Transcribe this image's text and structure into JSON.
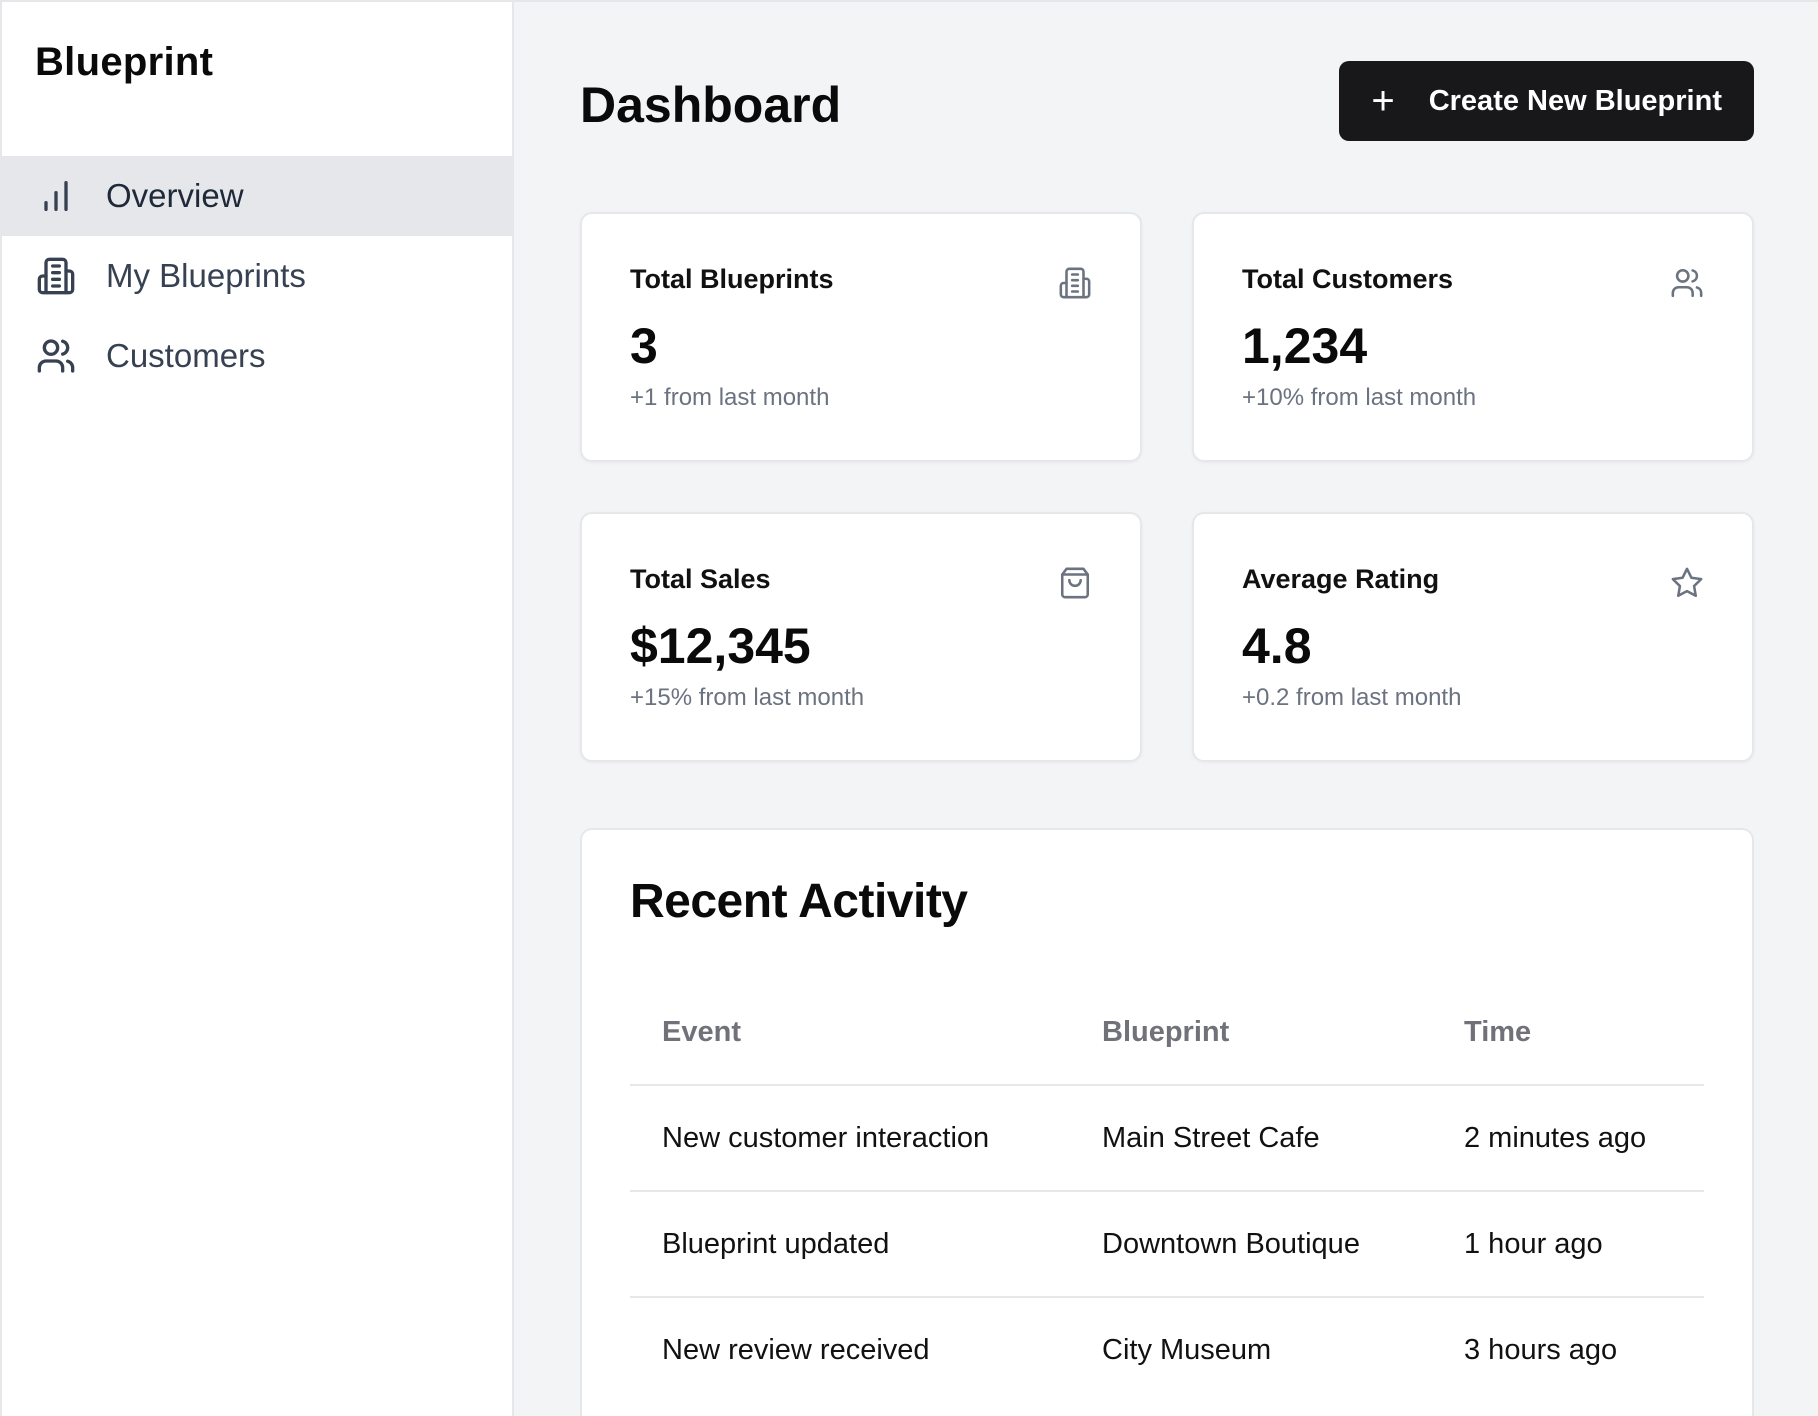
{
  "sidebar": {
    "brand": "Blueprint",
    "items": [
      {
        "label": "Overview",
        "icon": "bar-chart-icon",
        "active": true
      },
      {
        "label": "My Blueprints",
        "icon": "building-icon",
        "active": false
      },
      {
        "label": "Customers",
        "icon": "users-icon",
        "active": false
      }
    ]
  },
  "header": {
    "title": "Dashboard",
    "create_button": {
      "icon": "plus-icon",
      "label": "Create New Blueprint"
    }
  },
  "stats": [
    {
      "title": "Total Blueprints",
      "value": "3",
      "sub": "+1 from last month",
      "icon": "building-icon"
    },
    {
      "title": "Total Customers",
      "value": "1,234",
      "sub": "+10% from last month",
      "icon": "users-icon"
    },
    {
      "title": "Total Sales",
      "value": "$12,345",
      "sub": "+15% from last month",
      "icon": "shopping-bag-icon"
    },
    {
      "title": "Average Rating",
      "value": "4.8",
      "sub": "+0.2 from last month",
      "icon": "star-icon"
    }
  ],
  "activity": {
    "title": "Recent Activity",
    "columns": [
      "Event",
      "Blueprint",
      "Time"
    ],
    "rows": [
      {
        "event": "New customer interaction",
        "blueprint": "Main Street Cafe",
        "time": "2 minutes ago"
      },
      {
        "event": "Blueprint updated",
        "blueprint": "Downtown Boutique",
        "time": "1 hour ago"
      },
      {
        "event": "New review received",
        "blueprint": "City Museum",
        "time": "3 hours ago"
      }
    ]
  },
  "colors": {
    "background": "#f3f4f6",
    "sidebar_active": "#e5e7eb",
    "primary_button": "#18181b",
    "muted_text": "#6b7280",
    "border": "#e5e7eb"
  }
}
